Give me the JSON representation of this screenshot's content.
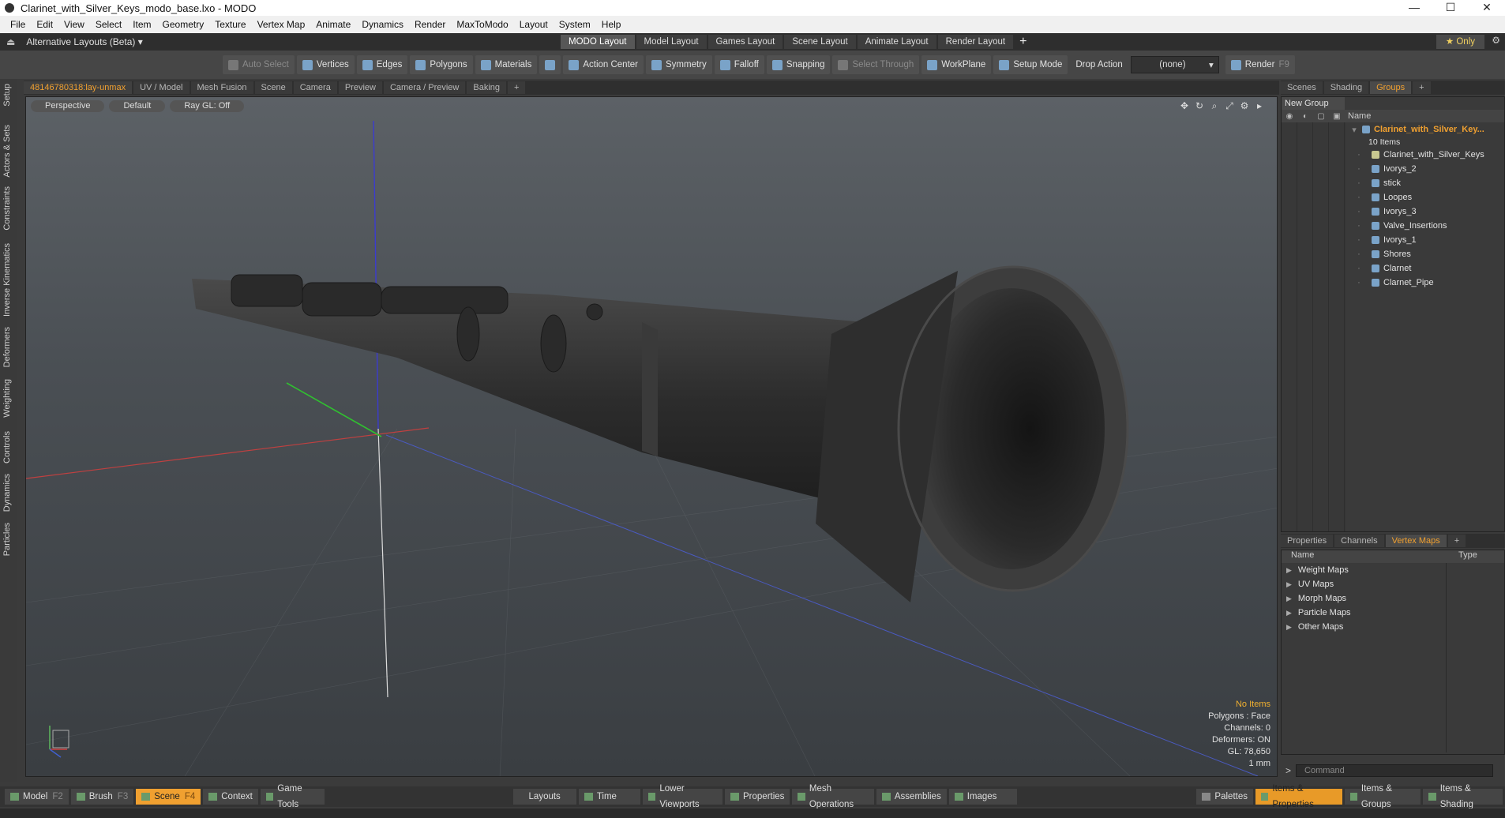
{
  "window": {
    "title": "Clarinet_with_Silver_Keys_modo_base.lxo - MODO",
    "controls": [
      "—",
      "☐",
      "✕"
    ]
  },
  "menu": [
    "File",
    "Edit",
    "View",
    "Select",
    "Item",
    "Geometry",
    "Texture",
    "Vertex Map",
    "Animate",
    "Dynamics",
    "Render",
    "MaxToModo",
    "Layout",
    "System",
    "Help"
  ],
  "layoutbar": {
    "alt_layouts": "Alternative Layouts (Beta) ▾",
    "tabs": [
      "MODO Layout",
      "Model Layout",
      "Games Layout",
      "Scene Layout",
      "Animate Layout",
      "Render Layout"
    ],
    "active_tab": "MODO Layout",
    "plus": "+",
    "only": "★  Only"
  },
  "toolbar": {
    "auto_select": "Auto Select",
    "vertices": "Vertices",
    "edges": "Edges",
    "polygons": "Polygons",
    "materials": "Materials",
    "action_center": "Action Center",
    "symmetry": "Symmetry",
    "falloff": "Falloff",
    "snapping": "Snapping",
    "select_through": "Select Through",
    "workplane": "WorkPlane",
    "setup_mode": "Setup Mode",
    "drop_action_label": "Drop Action",
    "drop_action_value": "(none)",
    "render": "Render",
    "render_key": "F9"
  },
  "left_tabs": [
    "Setup",
    "Actors & Sets",
    "Constraints",
    "Inverse Kinematics",
    "Deformers",
    "Weighting",
    "Controls",
    "Dynamics",
    "Particles"
  ],
  "viewport_tabs": [
    "48146780318:lay-unmax",
    "UV / Model",
    "Mesh Fusion",
    "Scene",
    "Camera",
    "Preview",
    "Camera / Preview",
    "Baking",
    "+"
  ],
  "viewport": {
    "projection": "Perspective",
    "shading": "Default",
    "raygl": "Ray GL: Off",
    "info": {
      "items": "No Items",
      "polygons": "Polygons : Face",
      "channels": "Channels: 0",
      "deformers": "Deformers: ON",
      "gl": "GL: 78,650",
      "unit": "1 mm"
    }
  },
  "groups_panel": {
    "tabs": [
      "Scenes",
      "Shading",
      "Groups",
      "+"
    ],
    "active_tab": "Groups",
    "new_group": "New Group",
    "name_header": "Name",
    "root": {
      "label": "Clarinet_with_Silver_Key...",
      "count": "10 Items"
    },
    "items": [
      "Clarinet_with_Silver_Keys",
      "Ivorys_2",
      "stick",
      "Loopes",
      "Ivorys_3",
      "Valve_Insertions",
      "Ivorys_1",
      "Shores",
      "Clarnet",
      "Clarnet_Pipe"
    ]
  },
  "vertex_panel": {
    "tabs": [
      "Properties",
      "Channels",
      "Vertex Maps",
      "+"
    ],
    "active_tab": "Vertex Maps",
    "name_header": "Name",
    "type_header": "Type",
    "rows": [
      "Weight Maps",
      "UV Maps",
      "Morph Maps",
      "Particle Maps",
      "Other Maps"
    ]
  },
  "command": {
    "arrow": ">",
    "placeholder": "Command"
  },
  "bottombar": {
    "left": [
      {
        "label": "Model",
        "key": "F2"
      },
      {
        "label": "Brush",
        "key": "F3"
      },
      {
        "label": "Scene",
        "key": "F4"
      },
      {
        "label": "Context",
        "key": ""
      },
      {
        "label": "Game Tools",
        "key": ""
      }
    ],
    "center": [
      "Layouts",
      "Time",
      "Lower Viewports",
      "Properties",
      "Mesh Operations",
      "Assemblies",
      "Images"
    ],
    "right": [
      "Palettes",
      "Items & Properties",
      "Items & Groups",
      "Items & Shading"
    ]
  },
  "colors": {
    "accent": "#f0a030",
    "viewport_top": "#5c6166",
    "viewport_bottom": "#3a3e42"
  }
}
